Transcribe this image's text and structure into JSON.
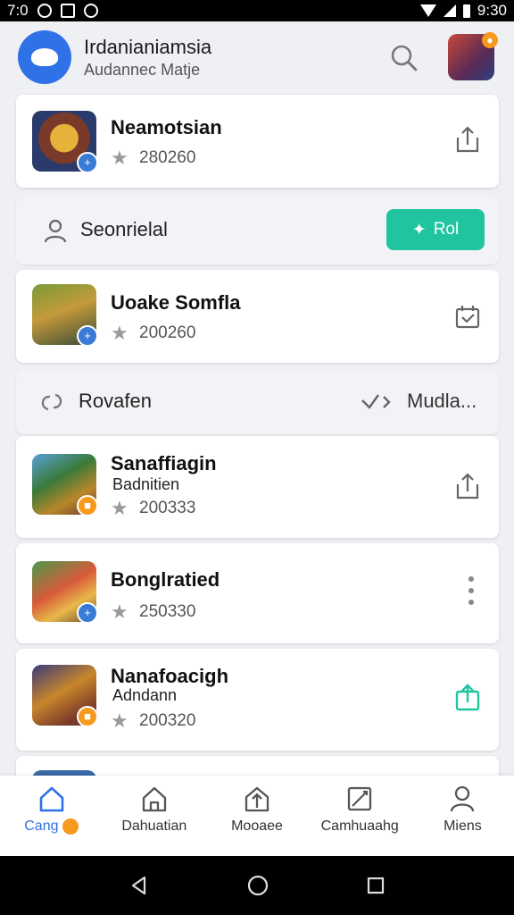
{
  "status_bar": {
    "time": "7:0",
    "clock": "9:30"
  },
  "header": {
    "title": "Irdanianiamsia",
    "subtitle": "Audannec Matje"
  },
  "cards": [
    {
      "title": "Neamotsian",
      "rating": "280260"
    },
    {
      "title": "Uoake Somfla",
      "rating": "200260"
    },
    {
      "title": "Sanaffiagin",
      "subtitle": "Badnitien",
      "rating": "200333"
    },
    {
      "title": "Bonglratied",
      "rating": "250330"
    },
    {
      "title": "Nanafoacigh",
      "subtitle": "Adndann",
      "rating": "200320"
    }
  ],
  "section_profile": {
    "label": "Seonrielal",
    "button_label": "Rol"
  },
  "section_recent": {
    "label": "Rovafen",
    "more_label": "Mudla..."
  },
  "bottom_nav": [
    {
      "label": "Cang",
      "active": true
    },
    {
      "label": "Dahuatian",
      "active": false
    },
    {
      "label": "Mooaee",
      "active": false
    },
    {
      "label": "Camhuaahg",
      "active": false
    },
    {
      "label": "Miens",
      "active": false
    }
  ],
  "colors": {
    "accent": "#2f72e8",
    "green": "#20c5a0",
    "badge_orange": "#f59a1e"
  },
  "icons": [
    "search-icon",
    "share-icon",
    "calendar-check-icon",
    "person-icon",
    "link-icon",
    "chevron-icon",
    "more-vert-icon",
    "home-icon",
    "house-icon",
    "upload-icon",
    "image-icon",
    "person-icon",
    "back-icon",
    "home-circle-icon",
    "recent-icon"
  ]
}
